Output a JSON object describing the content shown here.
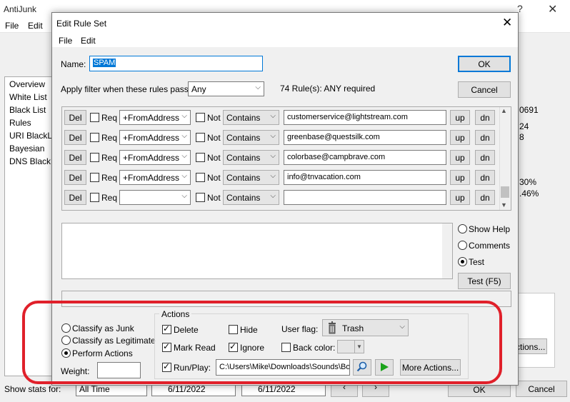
{
  "background_window": {
    "title": "AntiJunk",
    "help_glyph": "?",
    "close_glyph": "✕",
    "menu": [
      "File",
      "Edit"
    ],
    "nav_items": [
      "Overview",
      "White List",
      "Black List",
      "Rules",
      "URI BlackList",
      "Bayesian",
      "DNS BlackList"
    ],
    "right_stats": [
      "0691",
      "24",
      "8",
      "30%",
      ".46%"
    ],
    "actions_button": "ctions...",
    "show_stats_label": "Show stats for:",
    "stats_period": "All Time",
    "date_from": "6/11/2022",
    "date_to": "6/11/2022",
    "ok_label": "OK",
    "cancel_label": "Cancel"
  },
  "dialog": {
    "title": "Edit Rule Set",
    "close_glyph": "✕",
    "menu": [
      "File",
      "Edit"
    ],
    "name_label": "Name:",
    "name_value": "SPAM",
    "ok_label": "OK",
    "cancel_label": "Cancel",
    "filter_label": "Apply filter when these rules pass:",
    "filter_value": "Any",
    "rules_summary": "74 Rule(s): ANY required",
    "rule_labels": {
      "del": "Del",
      "req": "Req",
      "not": "Not",
      "up": "up",
      "dn": "dn"
    },
    "rules": [
      {
        "field": "+FromAddress",
        "operator": "Contains",
        "value": "customerservice@lightstream.com"
      },
      {
        "field": "+FromAddress",
        "operator": "Contains",
        "value": "greenbase@questsilk.com"
      },
      {
        "field": "+FromAddress",
        "operator": "Contains",
        "value": "colorbase@campbrave.com"
      },
      {
        "field": "+FromAddress",
        "operator": "Contains",
        "value": "info@tnvacation.com"
      },
      {
        "field": "",
        "operator": "Contains",
        "value": ""
      }
    ],
    "view_options": [
      "Show Help",
      "Comments",
      "Test"
    ],
    "view_selected": "Test",
    "test_button": "Test (F5)",
    "classify_options": [
      "Classify as Junk",
      "Classify as Legitimate",
      "Perform Actions"
    ],
    "classify_selected": "Perform Actions",
    "weight_label": "Weight:",
    "weight_value": "",
    "actions": {
      "title": "Actions",
      "delete": "Delete",
      "hide": "Hide",
      "user_flag_label": "User flag:",
      "user_flag_value": "Trash",
      "mark_read": "Mark Read",
      "ignore": "Ignore",
      "back_color": "Back color:",
      "run_play": "Run/Play:",
      "run_path": "C:\\Users\\Mike\\Downloads\\Sounds\\Boi",
      "more_actions": "More Actions..."
    }
  },
  "colors": {
    "highlight": "#e0202a",
    "selection": "#0078d7",
    "play": "#1aa31a"
  }
}
